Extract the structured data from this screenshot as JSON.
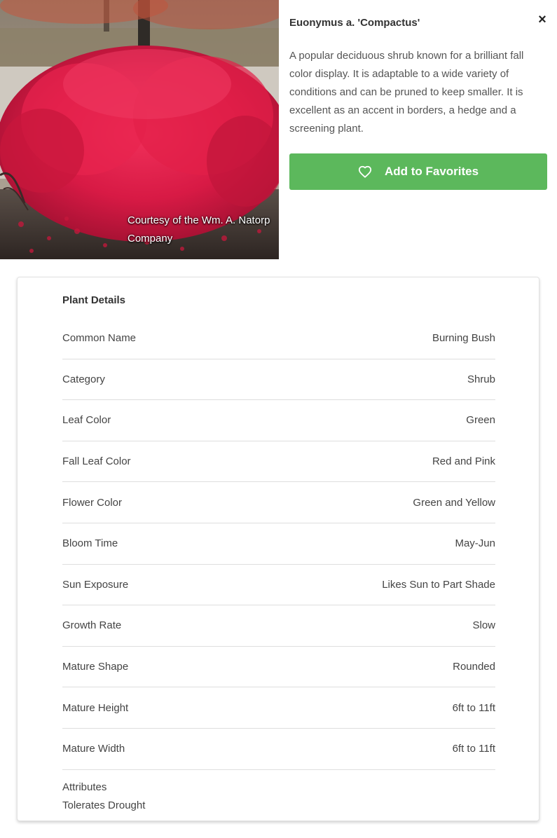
{
  "photo": {
    "credit": "Courtesy of the Wm. A. Natorp Company"
  },
  "header": {
    "title": "Euonymus a. 'Compactus'",
    "close_label": "×",
    "description": "A popular deciduous shrub known for a brilliant fall color display. It is adaptable to a wide variety of conditions and can be pruned to keep smaller. It is excellent as an accent in borders, a hedge and a screening plant."
  },
  "favorites": {
    "label": "Add to Favorites",
    "icon": "heart-outline-icon",
    "color": "#5cb85c"
  },
  "details": {
    "title": "Plant Details",
    "rows": [
      {
        "label": "Common Name",
        "value": "Burning Bush"
      },
      {
        "label": "Category",
        "value": "Shrub"
      },
      {
        "label": "Leaf Color",
        "value": "Green"
      },
      {
        "label": "Fall Leaf Color",
        "value": "Red and Pink"
      },
      {
        "label": "Flower Color",
        "value": "Green and Yellow"
      },
      {
        "label": "Bloom Time",
        "value": "May-Jun"
      },
      {
        "label": "Sun Exposure",
        "value": "Likes Sun to Part Shade"
      },
      {
        "label": "Growth Rate",
        "value": "Slow"
      },
      {
        "label": "Mature Shape",
        "value": "Rounded"
      },
      {
        "label": "Mature Height",
        "value": "6ft to 11ft"
      },
      {
        "label": "Mature Width",
        "value": "6ft to 11ft"
      }
    ],
    "attributes_label": "Attributes",
    "attributes": [
      "Tolerates Drought"
    ]
  }
}
